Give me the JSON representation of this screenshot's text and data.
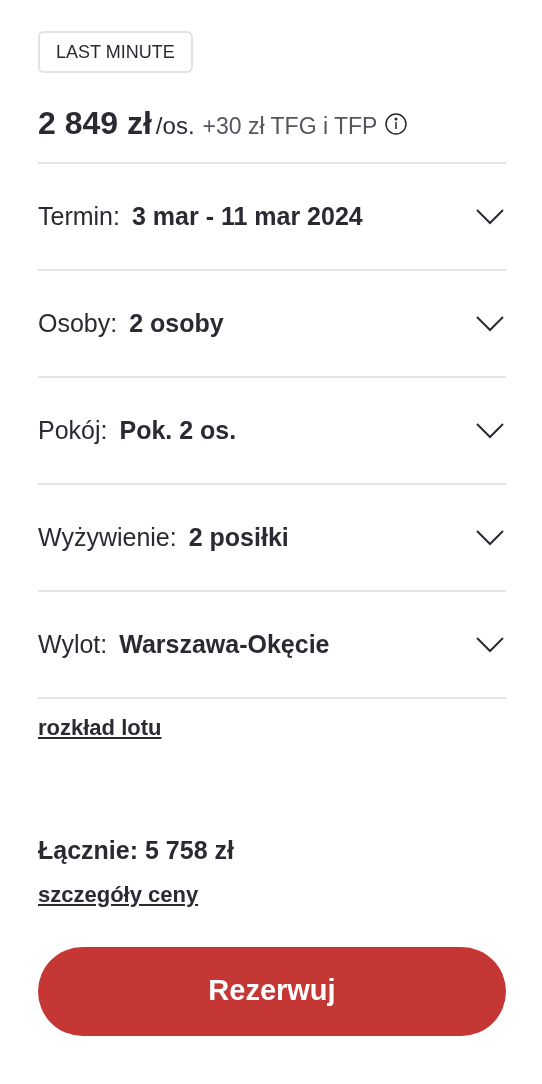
{
  "badge": "LAST MINUTE",
  "price": {
    "amount": "2 849 zł",
    "unit": "/os.",
    "extra": "+30 zł TFG i TFP"
  },
  "options": [
    {
      "label": "Termin:",
      "value": "3 mar - 11 mar 2024",
      "expanded": false
    },
    {
      "label": "Osoby:",
      "value": "2 osoby",
      "expanded": false
    },
    {
      "label": "Pokój:",
      "value": "Pok. 2 os.",
      "expanded": false
    },
    {
      "label": "Wyżywienie:",
      "value": "2 posiłki",
      "expanded": false
    },
    {
      "label": "Wylot:",
      "value": "Warszawa-Okęcie",
      "expanded": false
    }
  ],
  "flight_link": "rozkład lotu",
  "total": "Łącznie: 5 758 zł",
  "price_details_link": "szczegóły ceny",
  "reserve_button": "Rezerwuj"
}
